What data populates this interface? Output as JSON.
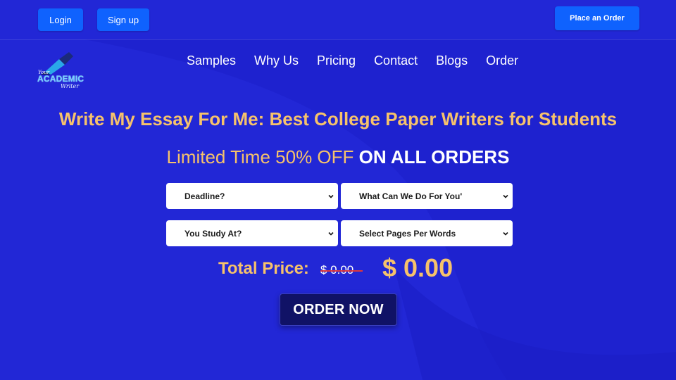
{
  "colors": {
    "background": "#2227d6",
    "button_blue": "#0f62fe",
    "accent_gold": "#f6c26b",
    "order_button": "#101266",
    "strike_red": "#e0383a"
  },
  "topbar": {
    "login_label": "Login",
    "signup_label": "Sign up",
    "place_order_label": "Place an Order"
  },
  "logo": {
    "line1": "Your",
    "line2": "ACADEMIC",
    "line3": "Writer"
  },
  "nav": {
    "items": [
      {
        "label": "Samples"
      },
      {
        "label": "Why Us"
      },
      {
        "label": "Pricing"
      },
      {
        "label": "Contact"
      },
      {
        "label": "Blogs"
      },
      {
        "label": "Order"
      }
    ]
  },
  "hero": {
    "headline": "Write My Essay For Me: Best College Paper Writers for Students",
    "promo_part1": "Limited Time 50% OFF",
    "promo_part2": "ON ALL ORDERS"
  },
  "form": {
    "deadline": "Deadline?",
    "service": "What Can We Do For You'",
    "study": "You Study At?",
    "pages": "Select Pages Per Words"
  },
  "price": {
    "label": "Total Price:",
    "old": "$ 0.00",
    "new": "$ 0.00"
  },
  "cta": {
    "order_now": "ORDER NOW"
  }
}
